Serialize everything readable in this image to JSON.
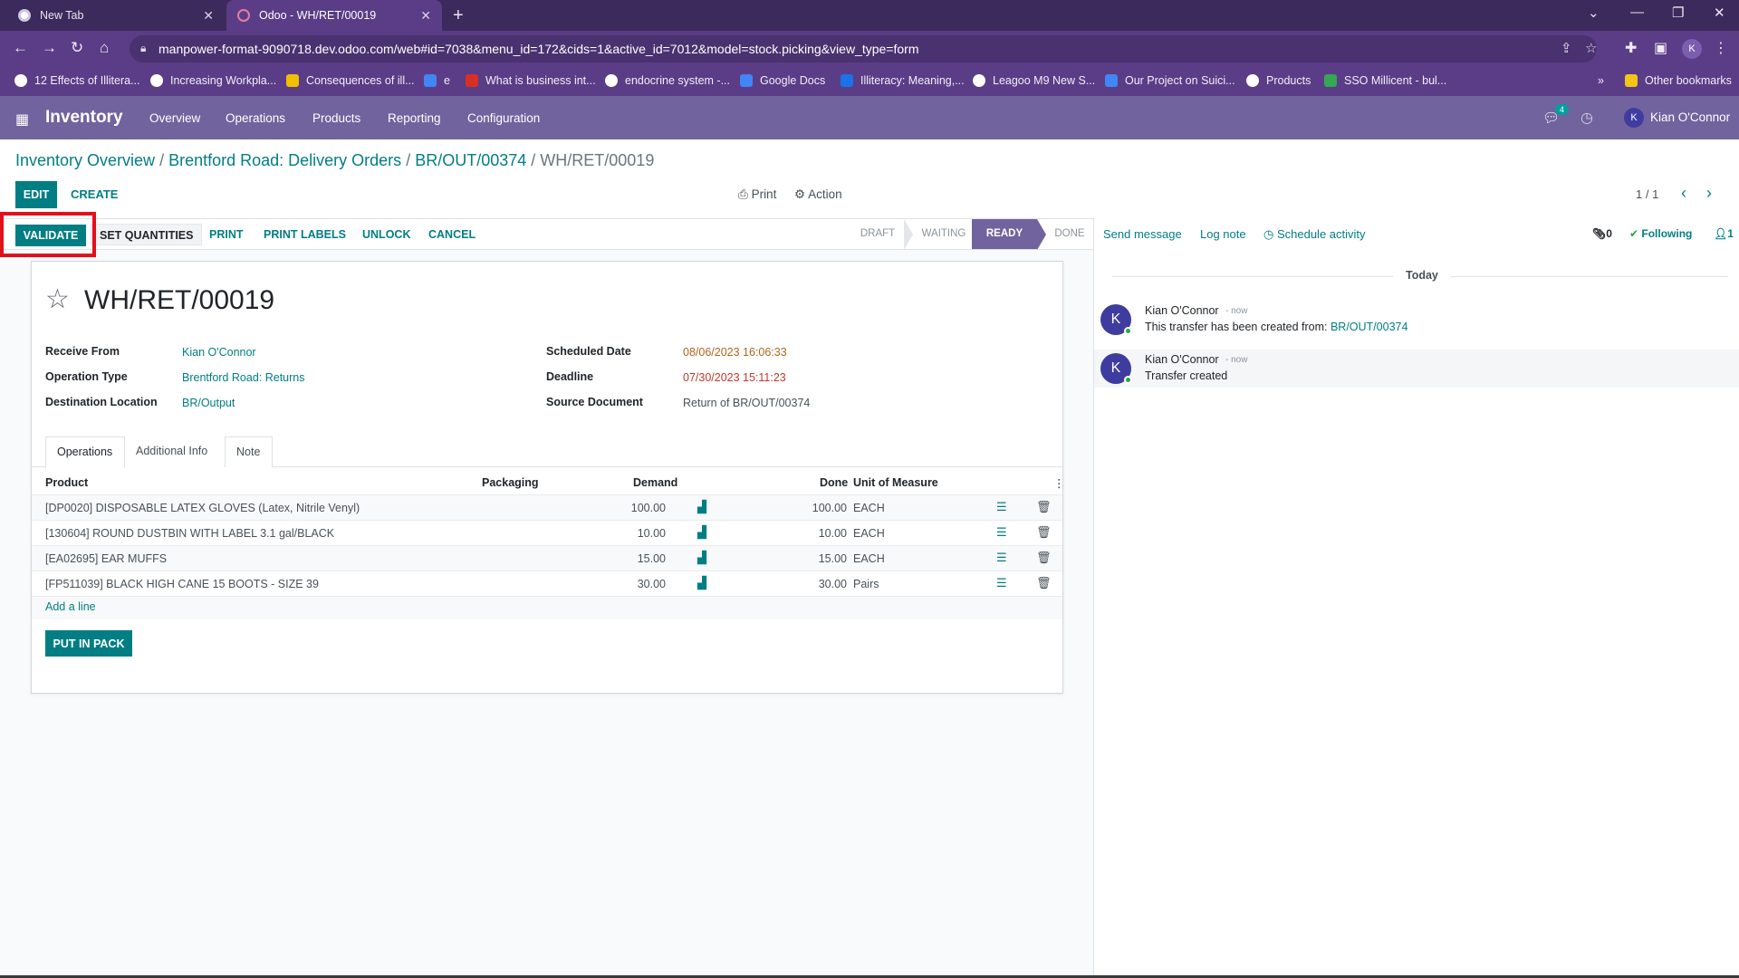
{
  "browser": {
    "tabs": [
      {
        "title": "New Tab"
      },
      {
        "title": "Odoo - WH/RET/00019"
      }
    ],
    "url": "manpower-format-9090718.dev.odoo.com/web#id=7038&menu_id=172&cids=1&active_id=7012&model=stock.picking&view_type=form",
    "profile_initial": "K",
    "bookmarks": [
      {
        "label": "12 Effects of Illitera...",
        "color": "#ffffff"
      },
      {
        "label": "Increasing Workpla...",
        "color": "#ffffff"
      },
      {
        "label": "Consequences of ill...",
        "color": "#f0c000"
      },
      {
        "label": "e",
        "color": "#4285f4"
      },
      {
        "label": "What is business int...",
        "color": "#d93025"
      },
      {
        "label": "endocrine system -...",
        "color": "#ffffff"
      },
      {
        "label": "Google Docs",
        "color": "#4285f4"
      },
      {
        "label": "Illiteracy: Meaning,...",
        "color": "#1a73e8"
      },
      {
        "label": "Leagoo M9 New S...",
        "color": "#ffffff"
      },
      {
        "label": "Our Project on Suici...",
        "color": "#4285f4"
      },
      {
        "label": "Products",
        "color": "#ffffff"
      },
      {
        "label": "SSO Millicent - bul...",
        "color": "#34a853"
      }
    ],
    "more_bookmarks": "»",
    "other_bookmarks": "Other bookmarks"
  },
  "odoo": {
    "app_name": "Inventory",
    "menu": [
      "Overview",
      "Operations",
      "Products",
      "Reporting",
      "Configuration"
    ],
    "chat_count": "4",
    "user_initial": "K",
    "user_name": "Kian O'Connor"
  },
  "control_panel": {
    "breadcrumb": [
      "Inventory Overview",
      "Brentford Road: Delivery Orders",
      "BR/OUT/00374"
    ],
    "breadcrumb_current": "WH/RET/00019",
    "edit_label": "EDIT",
    "create_label": "CREATE",
    "print_label": "Print",
    "action_label": "Action",
    "pager": "1 / 1"
  },
  "statusbar": {
    "validate_label": "VALIDATE",
    "set_quantities_label": "SET QUANTITIES",
    "print_label": "PRINT",
    "print_labels_label": "PRINT LABELS",
    "unlock_label": "UNLOCK",
    "cancel_label": "CANCEL",
    "stages": [
      "DRAFT",
      "WAITING",
      "READY",
      "DONE"
    ],
    "current_stage": "READY",
    "accent": "#71639e"
  },
  "form": {
    "title": "WH/RET/00019",
    "fields_left": [
      {
        "label": "Receive From",
        "value": "Kian O'Connor"
      },
      {
        "label": "Operation Type",
        "value": "Brentford Road: Returns"
      },
      {
        "label": "Destination Location",
        "value": "BR/Output"
      }
    ],
    "fields_right": [
      {
        "label": "Scheduled Date",
        "value": "08/06/2023 16:06:33"
      },
      {
        "label": "Deadline",
        "value": "07/30/2023 15:11:23"
      },
      {
        "label": "Source Document",
        "value": "Return of BR/OUT/00374"
      }
    ],
    "tabs": [
      "Operations",
      "Additional Info",
      "Note"
    ],
    "table": {
      "headers": {
        "product": "Product",
        "packaging": "Packaging",
        "demand": "Demand",
        "done": "Done",
        "uom": "Unit of Measure"
      },
      "rows": [
        {
          "product": "[DP0020] DISPOSABLE LATEX GLOVES (Latex, Nitrile Venyl)",
          "demand": "100.00",
          "done": "100.00",
          "uom": "EACH"
        },
        {
          "product": "[130604] ROUND DUSTBIN WITH LABEL 3.1 gal/BLACK",
          "demand": "10.00",
          "done": "10.00",
          "uom": "EACH"
        },
        {
          "product": "[EA02695] EAR MUFFS",
          "demand": "15.00",
          "done": "15.00",
          "uom": "EACH"
        },
        {
          "product": "[FP511039] BLACK HIGH CANE 15 BOOTS - SIZE 39",
          "demand": "30.00",
          "done": "30.00",
          "uom": "Pairs"
        }
      ]
    },
    "add_line": "Add a line",
    "put_in_pack": "PUT IN PACK"
  },
  "chatter": {
    "send_message": "Send message",
    "log_note": "Log note",
    "schedule_activity": "Schedule activity",
    "attachments": "0",
    "following": "Following",
    "followers": "1",
    "date_separator": "Today",
    "messages": [
      {
        "author": "Kian O'Connor",
        "when": "- now",
        "body": "This transfer has been created from:",
        "link": "BR/OUT/00374",
        "initial": "K"
      },
      {
        "author": "Kian O'Connor",
        "when": "- now",
        "body": "Transfer created",
        "link": "",
        "initial": "K"
      }
    ]
  }
}
